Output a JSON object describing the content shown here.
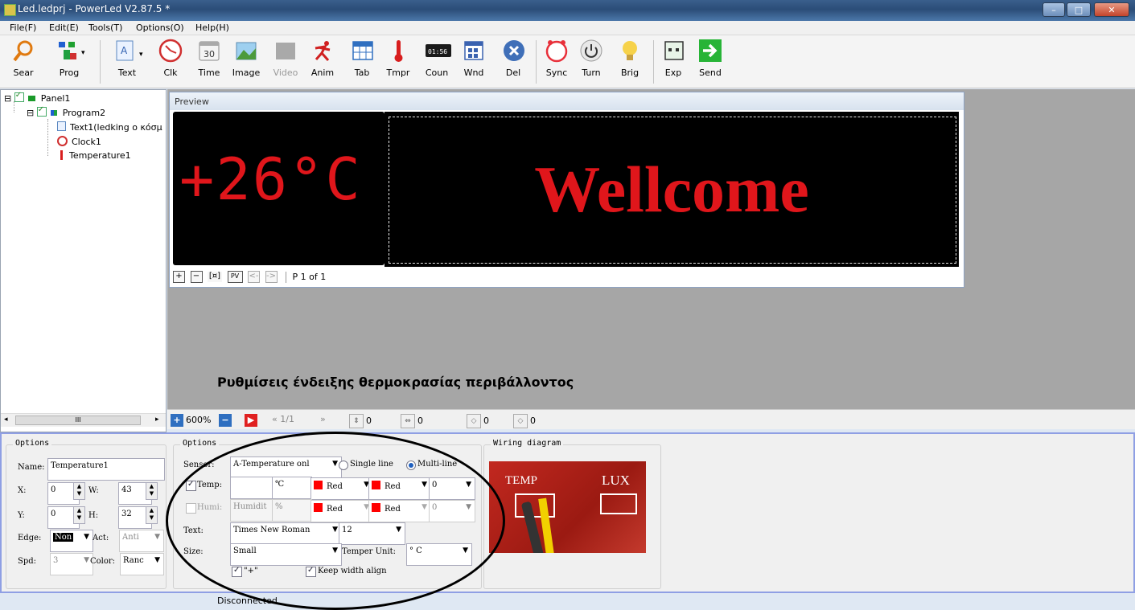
{
  "window": {
    "title": "Led.ledprj - PowerLed V2.87.5 *",
    "min": "–",
    "max": "□",
    "close": "✕"
  },
  "menu": [
    "File(F)",
    "Edit(E)",
    "Tools(T)",
    "Options(O)",
    "Help(H)"
  ],
  "toolbar": [
    {
      "label": "Sear",
      "icon": "search-icon"
    },
    {
      "label": "Prog",
      "icon": "program-icon"
    },
    {
      "label": "Text",
      "icon": "text-icon"
    },
    {
      "label": "Clk",
      "icon": "clock-icon"
    },
    {
      "label": "Time",
      "icon": "calendar-icon",
      "glyph": "30"
    },
    {
      "label": "Image",
      "icon": "image-icon"
    },
    {
      "label": "Video",
      "icon": "video-icon"
    },
    {
      "label": "Anim",
      "icon": "animation-icon"
    },
    {
      "label": "Tab",
      "icon": "table-icon"
    },
    {
      "label": "Tmpr",
      "icon": "thermometer-icon"
    },
    {
      "label": "Coun",
      "icon": "counter-icon",
      "glyph": "01:56"
    },
    {
      "label": "Wnd",
      "icon": "window-icon"
    },
    {
      "label": "Del",
      "icon": "delete-icon"
    },
    {
      "label": "Sync",
      "icon": "alarm-icon"
    },
    {
      "label": "Turn",
      "icon": "power-icon"
    },
    {
      "label": "Brig",
      "icon": "bulb-icon"
    },
    {
      "label": "Exp",
      "icon": "export-icon"
    },
    {
      "label": "Send",
      "icon": "send-arrow-icon"
    }
  ],
  "tree": {
    "panel": "Panel1",
    "program": "Program2",
    "items": [
      "Text1(ledking ο κόσμ",
      "Clock1",
      "Temperature1"
    ],
    "scroll": "III"
  },
  "preview": {
    "header": "Preview",
    "temp_display": "+26°C",
    "text_display": "Wellcome",
    "controls": [
      "+",
      "−",
      "[¤]",
      "PV",
      "<-",
      "->"
    ],
    "page": "P 1 of 1"
  },
  "caption": "Ρυθμίσεις ένδειξης θερμοκρασίας περιβάλλοντος",
  "zoombar": {
    "zoom": "600%",
    "frame": "1/1",
    "v1": "0",
    "v2": "0",
    "v3": "0",
    "v4": "0"
  },
  "options_left": {
    "title": "Options",
    "name_label": "Name:",
    "name": "Temperature1",
    "x_label": "X:",
    "x": "0",
    "w_label": "W:",
    "w": "43",
    "y_label": "Y:",
    "y": "0",
    "h_label": "H:",
    "h": "32",
    "edge_label": "Edge:",
    "edge": "Non",
    "act_label": "Act:",
    "act": "Anti",
    "spd_label": "Spd:",
    "spd": "3",
    "color_label": "Color:",
    "color": "Ranc"
  },
  "options_mid": {
    "title": "Options",
    "sensor_label": "Sensor:",
    "sensor": "A-Temperature onl",
    "single": "Single line",
    "multi": "Multi-line",
    "temp_label": "Temp:",
    "temp_value": "",
    "temp_unit": "℃",
    "temp_color1": "Red",
    "temp_color2": "Red",
    "temp_num": "0",
    "humi_label": "Humi:",
    "humi_value": "Humidit",
    "humi_unit": "%",
    "humi_color1": "Red",
    "humi_color2": "Red",
    "humi_num": "0",
    "text_label": "Text:",
    "font": "Times New Roman",
    "font_size": "12",
    "size_label": "Size:",
    "size": "Small",
    "unit_label": "Temper Unit:",
    "unit": "° C",
    "plus_label": "\"+\"",
    "keep_label": "Keep width align"
  },
  "wiring": {
    "title": "Wiring diagram",
    "temp": "TEMP",
    "lux": "LUX"
  },
  "status": "Disconnected",
  "colors": {
    "led_red": "#e0161b",
    "led_bg": "#000000",
    "panel_border": "#8f9fe4"
  }
}
